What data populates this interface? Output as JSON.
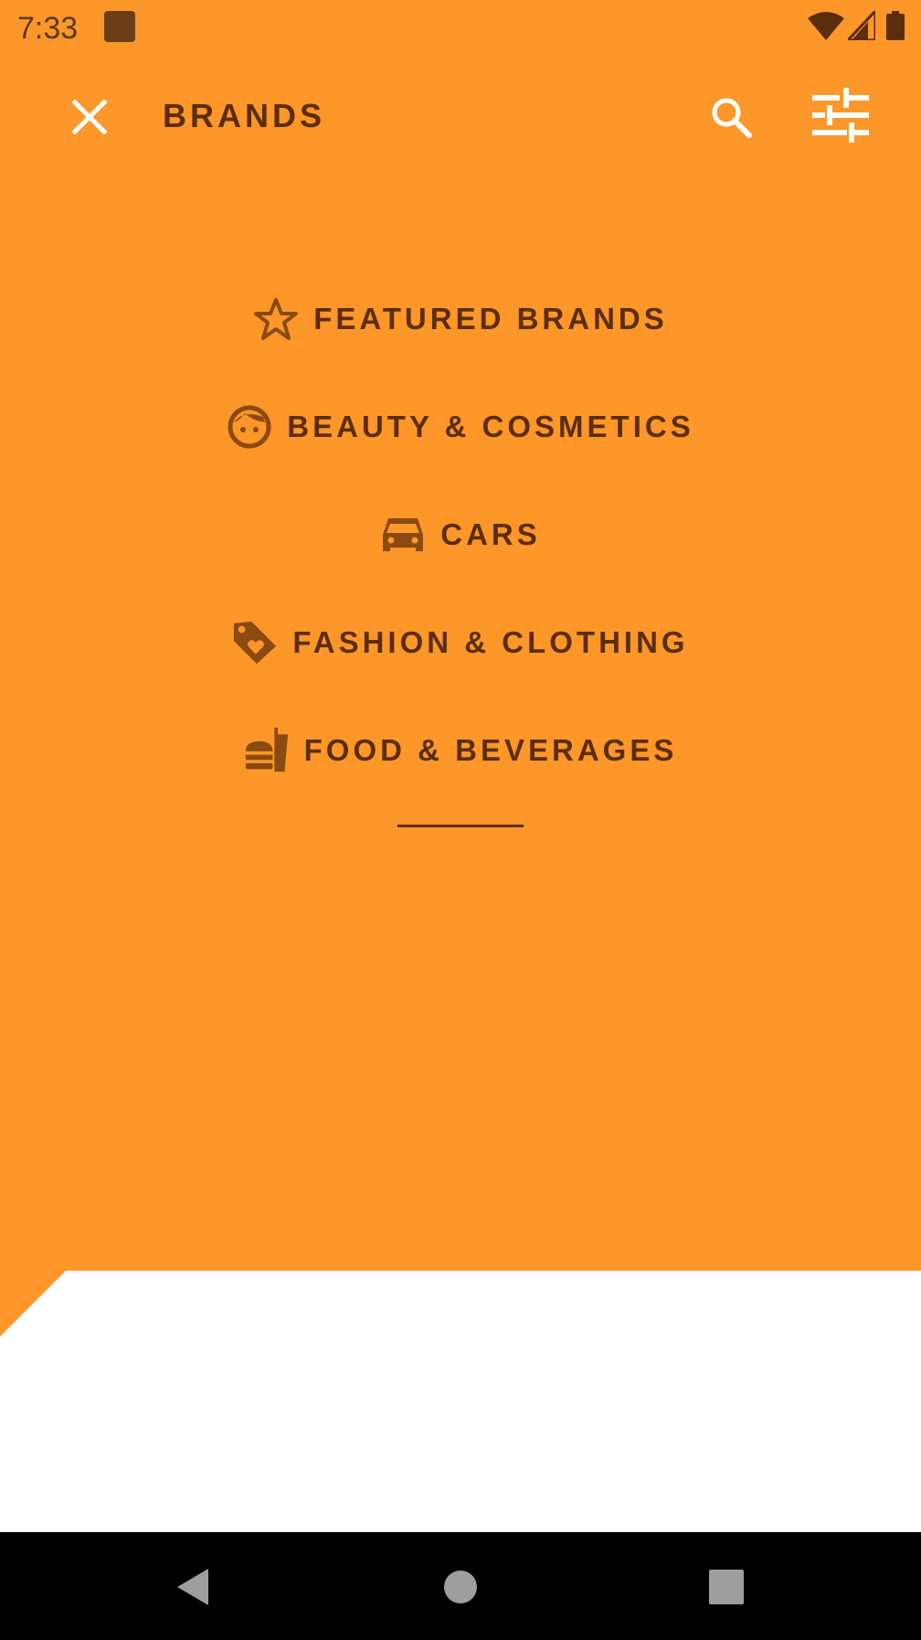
{
  "status_bar": {
    "time": "7:33",
    "icons": [
      "app-notification-icon",
      "wifi-icon",
      "cell-signal-icon",
      "battery-icon"
    ]
  },
  "toolbar": {
    "title": "BRANDS",
    "close_icon": "close-icon",
    "search_icon": "search-icon",
    "filter_icon": "tune-icon"
  },
  "menu": {
    "items": [
      {
        "label": "FEATURED BRANDS",
        "icon": "star-icon"
      },
      {
        "label": "BEAUTY & COSMETICS",
        "icon": "face-icon"
      },
      {
        "label": "CARS",
        "icon": "car-icon"
      },
      {
        "label": "FASHION & CLOTHING",
        "icon": "tag-heart-icon"
      },
      {
        "label": "FOOD & BEVERAGES",
        "icon": "fastfood-icon"
      }
    ]
  },
  "nav_bar": {
    "icons": [
      "back-icon",
      "home-icon",
      "recents-icon"
    ]
  },
  "colors": {
    "backdrop": "#FD9729",
    "text": "#5C2D0C",
    "sheet": "#FFFFFF",
    "navbar": "#000000"
  }
}
